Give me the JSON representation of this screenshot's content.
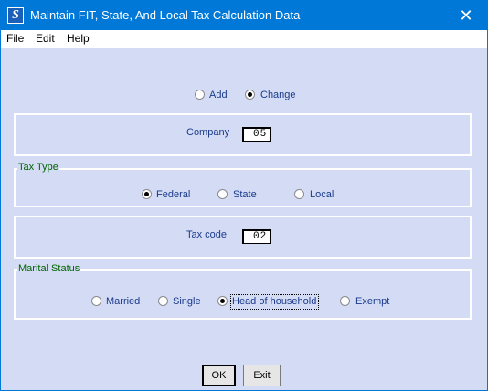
{
  "window": {
    "title": "Maintain FIT, State, And Local Tax Calculation Data",
    "close_glyph": "✕",
    "app_icon_letter": "S"
  },
  "menu": [
    "File",
    "Edit",
    "Help"
  ],
  "mode": {
    "options": [
      "Add",
      "Change"
    ],
    "selected": "Change"
  },
  "company": {
    "label": "Company",
    "value": "05"
  },
  "tax_type": {
    "legend": "Tax Type",
    "options": [
      "Federal",
      "State",
      "Local"
    ],
    "selected": "Federal"
  },
  "tax_code": {
    "label": "Tax code",
    "value": "02"
  },
  "marital_status": {
    "legend": "Marital Status",
    "options": [
      "Married",
      "Single",
      "Head of household",
      "Exempt"
    ],
    "selected": "Head of household"
  },
  "buttons": {
    "ok": "OK",
    "exit": "Exit"
  },
  "colors": {
    "titlebar": "#0078d7",
    "background": "#d4dcf5",
    "legend": "#006400",
    "label": "#1a3a8a"
  }
}
